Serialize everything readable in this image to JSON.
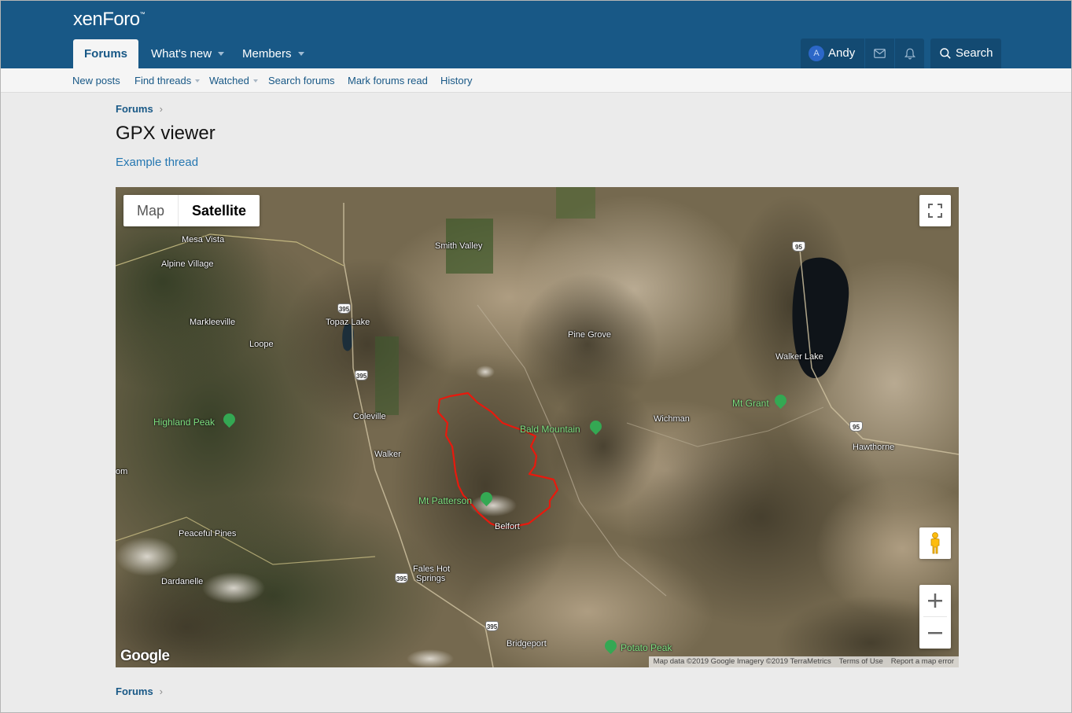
{
  "header": {
    "logo": "xenForo",
    "logo_mark": "™",
    "tabs": [
      {
        "label": "Forums",
        "active": true
      },
      {
        "label": "What's new",
        "has_menu": true
      },
      {
        "label": "Members",
        "has_menu": true
      }
    ],
    "user": {
      "avatar_letter": "A",
      "name": "Andy"
    },
    "icons": [
      "mail-icon",
      "bell-icon"
    ],
    "search_label": "Search"
  },
  "subnav": {
    "items": [
      {
        "label": "New posts"
      },
      {
        "label": "Find threads",
        "has_menu": true
      },
      {
        "label": "Watched",
        "has_menu": true
      },
      {
        "label": "Search forums"
      },
      {
        "label": "Mark forums read"
      },
      {
        "label": "History"
      }
    ]
  },
  "breadcrumb_top": {
    "label": "Forums"
  },
  "page": {
    "title": "GPX viewer",
    "thread_link": "Example thread"
  },
  "map": {
    "type_buttons": {
      "map": "Map",
      "satellite": "Satellite",
      "selected": "Satellite"
    },
    "controls": [
      "fullscreen-icon",
      "pegman-icon",
      "zoom-in-icon",
      "zoom-out-icon"
    ],
    "places": [
      "Mesa Vista",
      "Alpine Village",
      "Smith Valley",
      "Markleeville",
      "Topaz Lake",
      "Loope",
      "Pine Grove",
      "Walker Lake",
      "Coleville",
      "Walker",
      "Wichman",
      "Hawthorne",
      "Peaceful Pines",
      "Belfort",
      "Fales Hot",
      "Springs",
      "Dardanelle",
      "Bridgeport",
      "om"
    ],
    "peaks": [
      "Highland Peak",
      "Bald Mountain",
      "Mt Grant",
      "Mt Patterson",
      "Potato Peak"
    ],
    "route_shields": [
      "395",
      "395",
      "395",
      "395",
      "395",
      "95",
      "95"
    ],
    "google_logo": "Google",
    "attribution": {
      "data": "Map data ©2019 Google Imagery ©2019 TerraMetrics",
      "terms": "Terms of Use",
      "report": "Report a map error"
    },
    "track_color": "#e8190d"
  },
  "breadcrumb_bottom": {
    "label": "Forums"
  },
  "colors": {
    "header_bg": "#185886",
    "subnav_bg": "#f5f5f5",
    "link": "#185886",
    "page_bg": "#ebebeb"
  }
}
